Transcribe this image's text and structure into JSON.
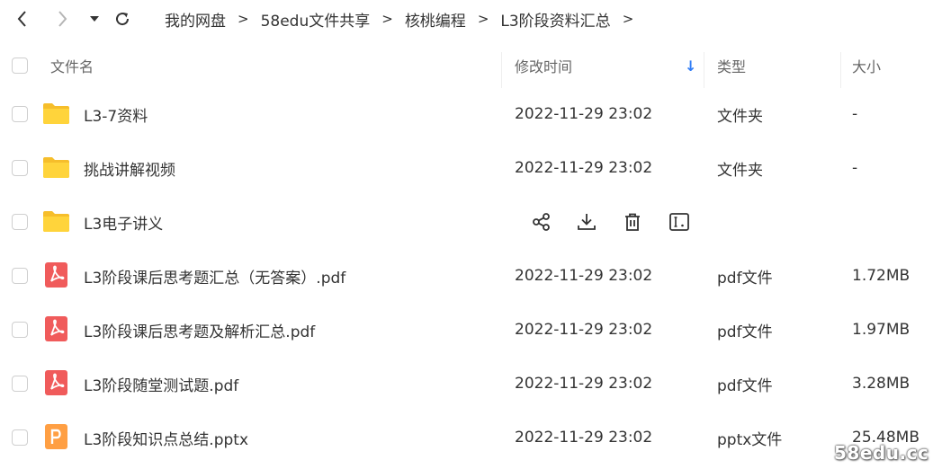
{
  "breadcrumb": {
    "items": [
      "我的网盘",
      "58edu文件共享",
      "核桃编程",
      "L3阶段资料汇总"
    ],
    "separator": ">"
  },
  "table": {
    "headers": {
      "name": "文件名",
      "modified": "修改时间",
      "type": "类型",
      "size": "大小"
    },
    "sort_indicator": "↓",
    "rows": [
      {
        "name": "L3-7资料",
        "modified": "2022-11-29 23:02",
        "type": "文件夹",
        "size": "-",
        "icon": "folder-icon"
      },
      {
        "name": "挑战讲解视频",
        "modified": "2022-11-29 23:02",
        "type": "文件夹",
        "size": "-",
        "icon": "folder-icon"
      },
      {
        "name": "L3电子讲义",
        "modified": "",
        "type": "",
        "size": "",
        "icon": "folder-icon"
      },
      {
        "name": "L3阶段课后思考题汇总（无答案）.pdf",
        "modified": "2022-11-29 23:02",
        "type": "pdf文件",
        "size": "1.72MB",
        "icon": "pdf-icon"
      },
      {
        "name": "L3阶段课后思考题及解析汇总.pdf",
        "modified": "2022-11-29 23:02",
        "type": "pdf文件",
        "size": "1.97MB",
        "icon": "pdf-icon"
      },
      {
        "name": "L3阶段随堂测试题.pdf",
        "modified": "2022-11-29 23:02",
        "type": "pdf文件",
        "size": "3.28MB",
        "icon": "pdf-icon"
      },
      {
        "name": "L3阶段知识点总结.pptx",
        "modified": "2022-11-29 23:02",
        "type": "pptx文件",
        "size": "25.48MB",
        "icon": "pptx-icon"
      }
    ]
  },
  "hover_actions": [
    "share-icon",
    "download-icon",
    "delete-icon",
    "rename-icon"
  ],
  "colors": {
    "folder": "#FFD43B",
    "pdf": "#F05B5B",
    "pptx": "#FF9F43",
    "sort_arrow": "#2F7CF6"
  },
  "watermark": "58edu.cc"
}
